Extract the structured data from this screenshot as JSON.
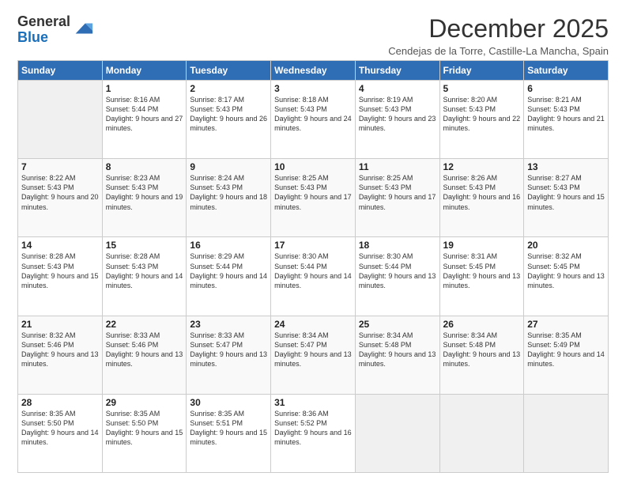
{
  "logo": {
    "general": "General",
    "blue": "Blue"
  },
  "header": {
    "month": "December 2025",
    "location": "Cendejas de la Torre, Castille-La Mancha, Spain"
  },
  "weekdays": [
    "Sunday",
    "Monday",
    "Tuesday",
    "Wednesday",
    "Thursday",
    "Friday",
    "Saturday"
  ],
  "weeks": [
    {
      "days": [
        {
          "num": "",
          "empty": true
        },
        {
          "num": "1",
          "sunrise": "Sunrise: 8:16 AM",
          "sunset": "Sunset: 5:44 PM",
          "daylight": "Daylight: 9 hours and 27 minutes."
        },
        {
          "num": "2",
          "sunrise": "Sunrise: 8:17 AM",
          "sunset": "Sunset: 5:43 PM",
          "daylight": "Daylight: 9 hours and 26 minutes."
        },
        {
          "num": "3",
          "sunrise": "Sunrise: 8:18 AM",
          "sunset": "Sunset: 5:43 PM",
          "daylight": "Daylight: 9 hours and 24 minutes."
        },
        {
          "num": "4",
          "sunrise": "Sunrise: 8:19 AM",
          "sunset": "Sunset: 5:43 PM",
          "daylight": "Daylight: 9 hours and 23 minutes."
        },
        {
          "num": "5",
          "sunrise": "Sunrise: 8:20 AM",
          "sunset": "Sunset: 5:43 PM",
          "daylight": "Daylight: 9 hours and 22 minutes."
        },
        {
          "num": "6",
          "sunrise": "Sunrise: 8:21 AM",
          "sunset": "Sunset: 5:43 PM",
          "daylight": "Daylight: 9 hours and 21 minutes."
        }
      ]
    },
    {
      "days": [
        {
          "num": "7",
          "sunrise": "Sunrise: 8:22 AM",
          "sunset": "Sunset: 5:43 PM",
          "daylight": "Daylight: 9 hours and 20 minutes."
        },
        {
          "num": "8",
          "sunrise": "Sunrise: 8:23 AM",
          "sunset": "Sunset: 5:43 PM",
          "daylight": "Daylight: 9 hours and 19 minutes."
        },
        {
          "num": "9",
          "sunrise": "Sunrise: 8:24 AM",
          "sunset": "Sunset: 5:43 PM",
          "daylight": "Daylight: 9 hours and 18 minutes."
        },
        {
          "num": "10",
          "sunrise": "Sunrise: 8:25 AM",
          "sunset": "Sunset: 5:43 PM",
          "daylight": "Daylight: 9 hours and 17 minutes."
        },
        {
          "num": "11",
          "sunrise": "Sunrise: 8:25 AM",
          "sunset": "Sunset: 5:43 PM",
          "daylight": "Daylight: 9 hours and 17 minutes."
        },
        {
          "num": "12",
          "sunrise": "Sunrise: 8:26 AM",
          "sunset": "Sunset: 5:43 PM",
          "daylight": "Daylight: 9 hours and 16 minutes."
        },
        {
          "num": "13",
          "sunrise": "Sunrise: 8:27 AM",
          "sunset": "Sunset: 5:43 PM",
          "daylight": "Daylight: 9 hours and 15 minutes."
        }
      ]
    },
    {
      "days": [
        {
          "num": "14",
          "sunrise": "Sunrise: 8:28 AM",
          "sunset": "Sunset: 5:43 PM",
          "daylight": "Daylight: 9 hours and 15 minutes."
        },
        {
          "num": "15",
          "sunrise": "Sunrise: 8:28 AM",
          "sunset": "Sunset: 5:43 PM",
          "daylight": "Daylight: 9 hours and 14 minutes."
        },
        {
          "num": "16",
          "sunrise": "Sunrise: 8:29 AM",
          "sunset": "Sunset: 5:44 PM",
          "daylight": "Daylight: 9 hours and 14 minutes."
        },
        {
          "num": "17",
          "sunrise": "Sunrise: 8:30 AM",
          "sunset": "Sunset: 5:44 PM",
          "daylight": "Daylight: 9 hours and 14 minutes."
        },
        {
          "num": "18",
          "sunrise": "Sunrise: 8:30 AM",
          "sunset": "Sunset: 5:44 PM",
          "daylight": "Daylight: 9 hours and 13 minutes."
        },
        {
          "num": "19",
          "sunrise": "Sunrise: 8:31 AM",
          "sunset": "Sunset: 5:45 PM",
          "daylight": "Daylight: 9 hours and 13 minutes."
        },
        {
          "num": "20",
          "sunrise": "Sunrise: 8:32 AM",
          "sunset": "Sunset: 5:45 PM",
          "daylight": "Daylight: 9 hours and 13 minutes."
        }
      ]
    },
    {
      "days": [
        {
          "num": "21",
          "sunrise": "Sunrise: 8:32 AM",
          "sunset": "Sunset: 5:46 PM",
          "daylight": "Daylight: 9 hours and 13 minutes."
        },
        {
          "num": "22",
          "sunrise": "Sunrise: 8:33 AM",
          "sunset": "Sunset: 5:46 PM",
          "daylight": "Daylight: 9 hours and 13 minutes."
        },
        {
          "num": "23",
          "sunrise": "Sunrise: 8:33 AM",
          "sunset": "Sunset: 5:47 PM",
          "daylight": "Daylight: 9 hours and 13 minutes."
        },
        {
          "num": "24",
          "sunrise": "Sunrise: 8:34 AM",
          "sunset": "Sunset: 5:47 PM",
          "daylight": "Daylight: 9 hours and 13 minutes."
        },
        {
          "num": "25",
          "sunrise": "Sunrise: 8:34 AM",
          "sunset": "Sunset: 5:48 PM",
          "daylight": "Daylight: 9 hours and 13 minutes."
        },
        {
          "num": "26",
          "sunrise": "Sunrise: 8:34 AM",
          "sunset": "Sunset: 5:48 PM",
          "daylight": "Daylight: 9 hours and 13 minutes."
        },
        {
          "num": "27",
          "sunrise": "Sunrise: 8:35 AM",
          "sunset": "Sunset: 5:49 PM",
          "daylight": "Daylight: 9 hours and 14 minutes."
        }
      ]
    },
    {
      "days": [
        {
          "num": "28",
          "sunrise": "Sunrise: 8:35 AM",
          "sunset": "Sunset: 5:50 PM",
          "daylight": "Daylight: 9 hours and 14 minutes."
        },
        {
          "num": "29",
          "sunrise": "Sunrise: 8:35 AM",
          "sunset": "Sunset: 5:50 PM",
          "daylight": "Daylight: 9 hours and 15 minutes."
        },
        {
          "num": "30",
          "sunrise": "Sunrise: 8:35 AM",
          "sunset": "Sunset: 5:51 PM",
          "daylight": "Daylight: 9 hours and 15 minutes."
        },
        {
          "num": "31",
          "sunrise": "Sunrise: 8:36 AM",
          "sunset": "Sunset: 5:52 PM",
          "daylight": "Daylight: 9 hours and 16 minutes."
        },
        {
          "num": "",
          "empty": true
        },
        {
          "num": "",
          "empty": true
        },
        {
          "num": "",
          "empty": true
        }
      ]
    }
  ]
}
